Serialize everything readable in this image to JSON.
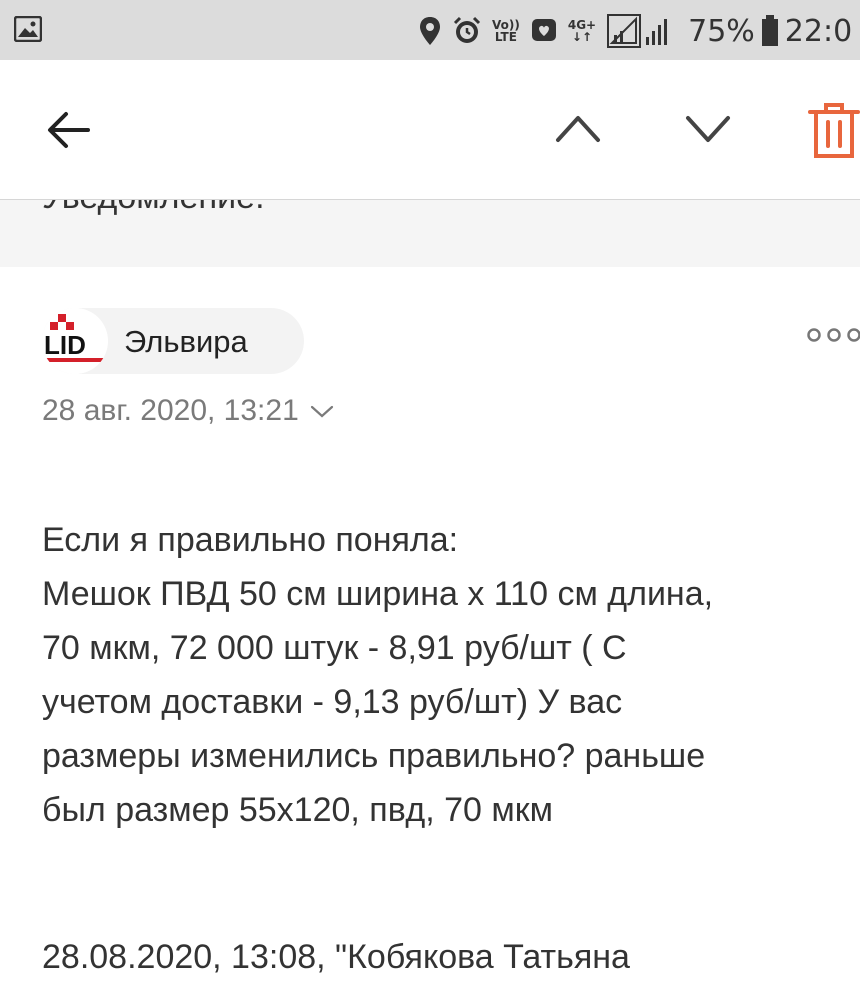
{
  "status_bar": {
    "left_icon": "gallery-icon",
    "icons": [
      "location-icon",
      "alarm-icon",
      "volte-icon",
      "message-icon",
      "4g-data-icon",
      "signal-icon"
    ],
    "volte_top": "Vo))",
    "volte_bottom": "LTE",
    "data_top": "4G+",
    "data_bottom": "↓↑",
    "battery": "75%",
    "time": "22:0"
  },
  "toolbar": {
    "back_icon": "arrow-left-icon",
    "prev_icon": "chevron-up-icon",
    "next_icon": "chevron-down-icon",
    "delete_icon": "trash-icon",
    "delete_color": "#e8663d"
  },
  "previous_message": {
    "text": "Уведомление."
  },
  "message": {
    "sender_logo_text": "LID",
    "sender_name": "Эльвира",
    "date": "28 авг. 2020, 13:21",
    "more_icon": "more-dots-icon",
    "body_lines": [
      "Если я правильно поняла:",
      "Мешок ПВД 50 см ширина х 110 см длина,",
      "70 мкм, 72 000 штук - 8,91 руб/шт ( С",
      "учетом доставки - 9,13 руб/шт) У вас",
      "размеры изменились правильно? раньше",
      "был размер 55х120, пвд, 70 мкм"
    ],
    "quote_header": "28.08.2020, 13:08, \"Кобякова Татьяна"
  },
  "colors": {
    "status_bar_bg": "#dcdcdc",
    "accent_red": "#e8663d",
    "logo_red": "#d4202a"
  }
}
